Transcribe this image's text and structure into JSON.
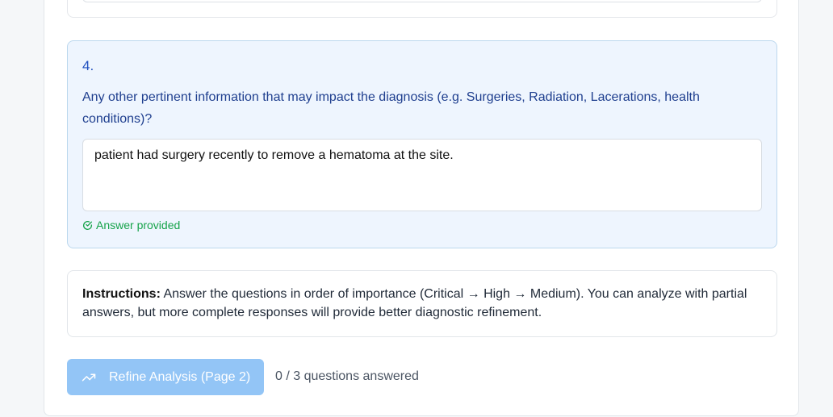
{
  "question": {
    "number": "4.",
    "text": "Any other pertinent information that may impact the diagnosis (e.g. Surgeries, Radiation, Lacerations, health conditions)?",
    "answer_value": "patient had surgery recently to remove a hematoma at the site.",
    "status": "Answer provided"
  },
  "instructions": {
    "label": "Instructions:",
    "text": " Answer the questions in order of importance (Critical → High → Medium). You can analyze with partial answers, but more complete responses will provide better diagnostic refinement."
  },
  "actions": {
    "refine_label": "Refine Analysis (Page 2)",
    "progress_text": "0 / 3 questions answered"
  },
  "icons": {
    "status": "check-circle-icon",
    "refine": "trending-up-icon"
  },
  "colors": {
    "accent": "#1f4fbf",
    "success": "#16a34a",
    "button_disabled": "#93c5f6",
    "question_bg": "#eef5fe"
  }
}
